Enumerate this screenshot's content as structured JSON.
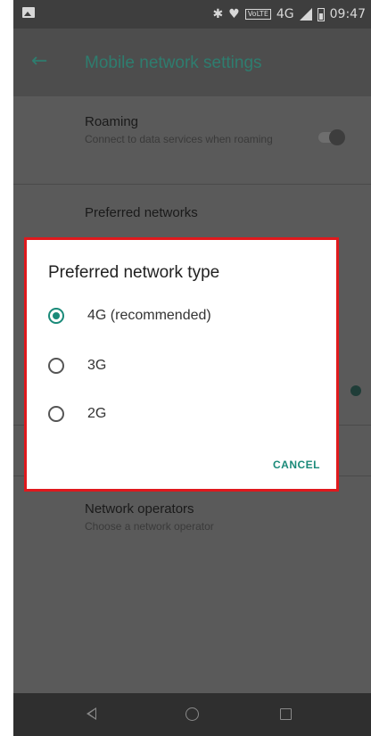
{
  "status_bar": {
    "network": "4G",
    "volte": "VoLTE",
    "time": "09:47"
  },
  "toolbar": {
    "title": "Mobile network settings"
  },
  "settings": {
    "roaming": {
      "title": "Roaming",
      "subtitle": "Connect to data services when roaming",
      "enabled": false
    },
    "preferred_networks": {
      "title": "Preferred networks"
    },
    "network_operators": {
      "title": "Network operators",
      "subtitle": "Choose a network operator"
    }
  },
  "dialog": {
    "title": "Preferred network type",
    "options": [
      {
        "label": "4G (recommended)",
        "selected": true
      },
      {
        "label": "3G",
        "selected": false
      },
      {
        "label": "2G",
        "selected": false
      }
    ],
    "cancel_label": "CANCEL"
  },
  "colors": {
    "accent": "#1a8a79",
    "highlight_border": "#e0191d"
  }
}
